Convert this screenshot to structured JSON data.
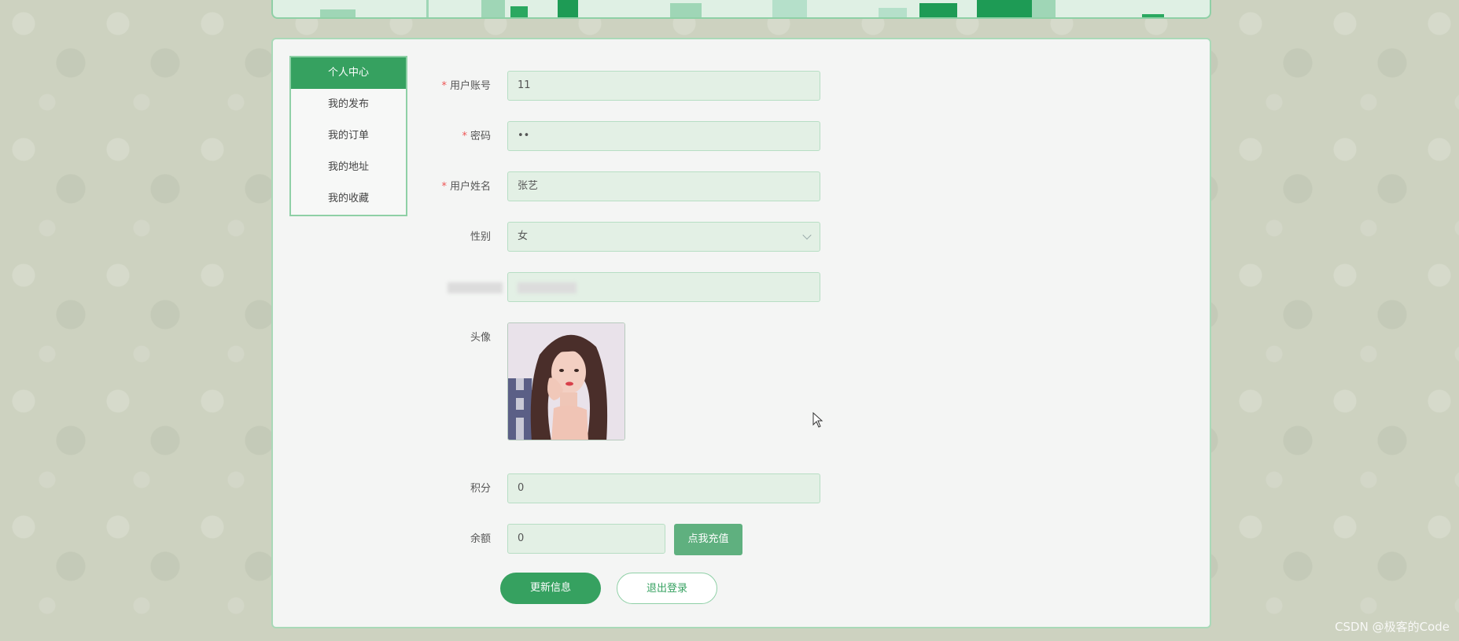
{
  "menu": {
    "items": [
      {
        "label": "个人中心",
        "active": true
      },
      {
        "label": "我的发布",
        "active": false
      },
      {
        "label": "我的订单",
        "active": false
      },
      {
        "label": "我的地址",
        "active": false
      },
      {
        "label": "我的收藏",
        "active": false
      }
    ]
  },
  "form": {
    "account": {
      "label": "用户账号",
      "value": "11",
      "required": true
    },
    "password": {
      "label": "密码",
      "value": "••",
      "required": true
    },
    "name": {
      "label": "用户姓名",
      "value": "张艺",
      "required": true
    },
    "gender": {
      "label": "性别",
      "value": "女"
    },
    "avatar": {
      "label": "头像"
    },
    "points": {
      "label": "积分",
      "value": "0"
    },
    "balance": {
      "label": "余额",
      "value": "0"
    },
    "recharge_label": "点我充值"
  },
  "actions": {
    "update_label": "更新信息",
    "logout_label": "退出登录"
  },
  "watermark": "CSDN @极客的Code",
  "colors": {
    "accent": "#36a160",
    "field_bg": "#e3f0e5",
    "field_border": "#b7dec4",
    "required": "#ee5555"
  }
}
